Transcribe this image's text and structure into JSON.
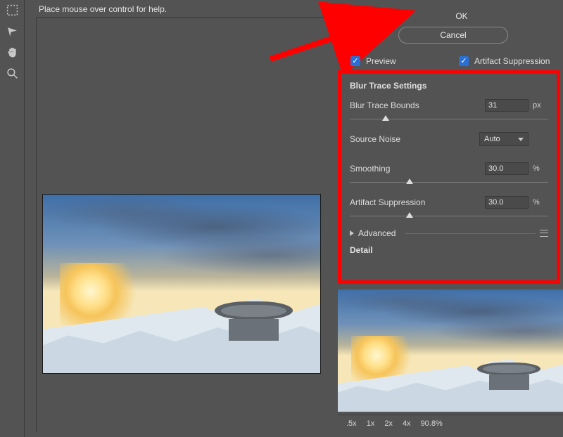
{
  "help_text": "Place mouse over control for help.",
  "buttons": {
    "ok": "OK",
    "cancel": "Cancel"
  },
  "checkboxes": {
    "preview": "Preview",
    "artifact_suppression": "Artifact Suppression"
  },
  "settings": {
    "title": "Blur Trace Settings",
    "blur_trace_bounds": {
      "label": "Blur Trace Bounds",
      "value": "31",
      "unit": "px",
      "slider_pct": 18
    },
    "source_noise": {
      "label": "Source Noise",
      "value": "Auto"
    },
    "smoothing": {
      "label": "Smoothing",
      "value": "30.0",
      "unit": "%",
      "slider_pct": 30
    },
    "artifact_suppression": {
      "label": "Artifact Suppression",
      "value": "30.0",
      "unit": "%",
      "slider_pct": 30
    },
    "advanced": "Advanced",
    "detail": "Detail"
  },
  "zoom": {
    "levels": [
      ".5x",
      "1x",
      "2x",
      "4x"
    ],
    "value": "90.8%"
  },
  "icons": {
    "marquee": "marquee-icon",
    "lasso": "lasso-icon",
    "hand": "hand-icon",
    "zoom": "zoom-icon"
  }
}
